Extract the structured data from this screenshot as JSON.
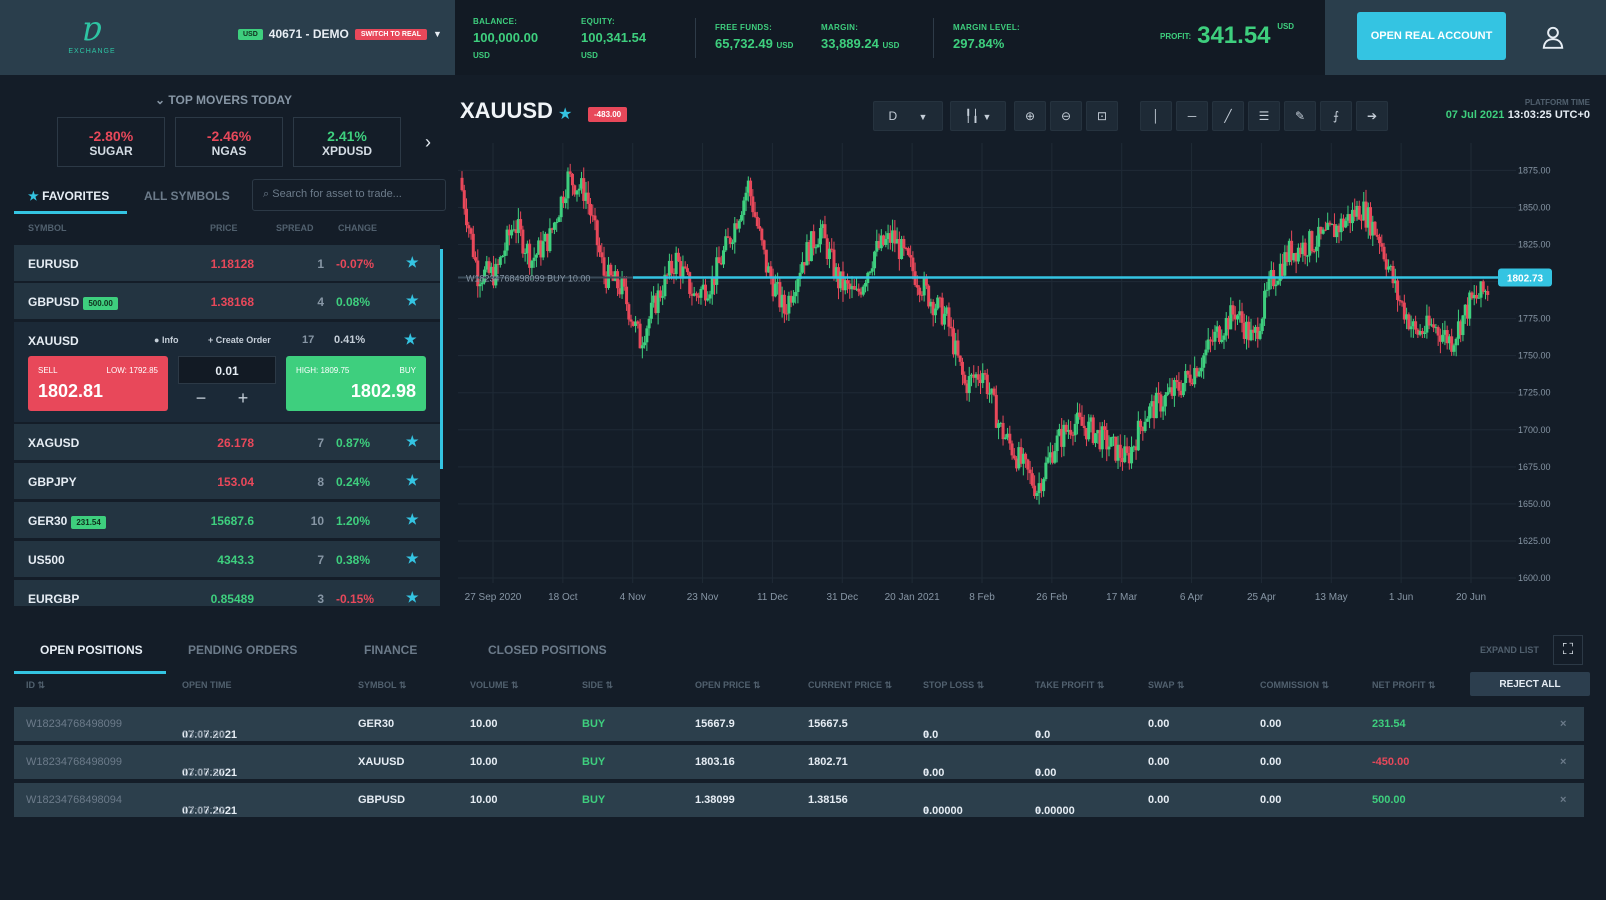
{
  "header": {
    "logo_mark": "ɐ",
    "logo_text": "EXCHANGE",
    "account_tag": "USD",
    "account_name": "40671 - DEMO",
    "account_badge": "SWITCH TO REAL",
    "stats": [
      {
        "label": "BALANCE:",
        "value": "100,000.00",
        "unit": "USD"
      },
      {
        "label": "EQUITY:",
        "value": "100,341.54",
        "unit": "USD"
      },
      {
        "label": "FREE FUNDS:",
        "value": "65,732.49",
        "unit": "USD"
      },
      {
        "label": "MARGIN:",
        "value": "33,889.24",
        "unit": "USD"
      },
      {
        "label": "MARGIN LEVEL:",
        "value": "297.84%",
        "unit": ""
      }
    ],
    "profit_label": "PROFIT:",
    "profit_value": "341.54",
    "profit_unit": "USD",
    "open_real_label": "OPEN REAL ACCOUNT"
  },
  "movers": {
    "title": "TOP MOVERS TODAY",
    "items": [
      {
        "pct": "-2.80%",
        "name": "SUGAR",
        "dir": "down"
      },
      {
        "pct": "-2.46%",
        "name": "NGAS",
        "dir": "down"
      },
      {
        "pct": "2.41%",
        "name": "XPDUSD",
        "dir": "up"
      }
    ]
  },
  "symbols": {
    "tab_favorites": "FAVORITES",
    "tab_all": "ALL SYMBOLS",
    "search_placeholder": "Search for asset to trade...",
    "columns": [
      "SYMBOL",
      "PRICE",
      "SPREAD",
      "CHANGE"
    ],
    "rows": [
      {
        "symbol": "EURUSD",
        "badge": "",
        "price": "1.18128",
        "spread": "1",
        "change": "-0.07%",
        "price_dir": "down",
        "change_dir": "down"
      },
      {
        "symbol": "GBPUSD",
        "badge": "500.00",
        "price": "1.38168",
        "spread": "4",
        "change": "0.08%",
        "price_dir": "down",
        "change_dir": "up"
      },
      {
        "symbol": "XAGUSD",
        "badge": "",
        "price": "26.178",
        "spread": "7",
        "change": "0.87%",
        "price_dir": "down",
        "change_dir": "up"
      },
      {
        "symbol": "GBPJPY",
        "badge": "",
        "price": "153.04",
        "spread": "8",
        "change": "0.24%",
        "price_dir": "down",
        "change_dir": "up"
      },
      {
        "symbol": "GER30",
        "badge": "231.54",
        "price": "15687.6",
        "spread": "10",
        "change": "1.20%",
        "price_dir": "up",
        "change_dir": "up"
      },
      {
        "symbol": "US500",
        "badge": "",
        "price": "4343.3",
        "spread": "7",
        "change": "0.38%",
        "price_dir": "up",
        "change_dir": "up"
      },
      {
        "symbol": "EURGBP",
        "badge": "",
        "price": "0.85489",
        "spread": "3",
        "change": "-0.15%",
        "price_dir": "up",
        "change_dir": "down"
      }
    ],
    "expanded": {
      "symbol": "XAUUSD",
      "info_label": "Info",
      "create_order_label": "Create Order",
      "spread": "17",
      "change": "0.41%",
      "sell_label": "SELL",
      "sell_low": "LOW: 1792.85",
      "sell_price": "1802.81",
      "buy_label": "BUY",
      "buy_high": "HIGH: 1809.75",
      "buy_price": "1802.98",
      "volume": "0.01",
      "minus": "−",
      "plus": "+"
    }
  },
  "chart": {
    "symbol": "XAUUSD",
    "badge": "-483.00",
    "timeframe": "D",
    "platform_time_label": "PLATFORM TIME",
    "platform_date": "07 Jul 2021",
    "platform_time": "13:03:25 UTC+0",
    "position_line_label": "W18234768498099 BUY 10.00",
    "current_price_label": "1802.73"
  },
  "chart_data": {
    "type": "line",
    "title": "",
    "xlabel": "",
    "ylabel": "",
    "x": [
      "27 Sep 2020",
      "18 Oct",
      "4 Nov",
      "23 Nov",
      "11 Dec",
      "31 Dec",
      "20 Jan 2021",
      "8 Feb",
      "26 Feb",
      "17 Mar",
      "6 Apr",
      "25 Apr",
      "13 May",
      "1 Jun",
      "20 Jun"
    ],
    "y_ticks": [
      "1875.00",
      "1850.00",
      "1825.00",
      "1800.00",
      "1775.00",
      "1750.00",
      "1725.00",
      "1700.00",
      "1675.00",
      "1650.00",
      "1625.00",
      "1600.00"
    ],
    "ylim": [
      1600,
      1880
    ],
    "series": [
      {
        "values": [
          1870,
          1805,
          1805,
          1840,
          1815,
          1830,
          1870,
          1860,
          1805,
          1795,
          1760,
          1790,
          1815,
          1790,
          1800,
          1830,
          1865,
          1810,
          1780,
          1815,
          1835,
          1800,
          1790,
          1820,
          1830,
          1810,
          1790,
          1775,
          1730,
          1740,
          1700,
          1680,
          1660,
          1690,
          1705,
          1700,
          1690,
          1680,
          1710,
          1720,
          1730,
          1745,
          1765,
          1780,
          1760,
          1800,
          1820,
          1825,
          1830,
          1840,
          1850,
          1830,
          1790,
          1765,
          1770,
          1760,
          1785,
          1795
        ]
      }
    ],
    "price_line": 1802.73
  },
  "positions": {
    "tabs": [
      "OPEN POSITIONS",
      "PENDING ORDERS",
      "FINANCE",
      "CLOSED POSITIONS"
    ],
    "expand_label": "EXPAND LIST",
    "columns": [
      "ID ⇅",
      "OPEN TIME",
      "SYMBOL ⇅",
      "VOLUME ⇅",
      "SIDE ⇅",
      "OPEN PRICE ⇅",
      "CURRENT PRICE ⇅",
      "STOP LOSS ⇅",
      "TAKE PROFIT ⇅",
      "SWAP ⇅",
      "COMMISSION ⇅",
      "NET PROFIT ⇅"
    ],
    "reject_all_label": "REJECT ALL",
    "rows": [
      {
        "id": "W18234768498099",
        "date": "07.07.2021",
        "time": "13:00:00",
        "symbol": "GER30",
        "volume": "10.00",
        "side": "BUY",
        "open_price": "15667.9",
        "current_price": "15667.5",
        "stop_loss": "0.0",
        "take_profit": "0.0",
        "swap": "0.00",
        "commission": "0.00",
        "net_profit": "231.54",
        "profit_dir": "up"
      },
      {
        "id": "W18234768498099",
        "date": "07.07.2021",
        "time": "13:00:57",
        "symbol": "XAUUSD",
        "volume": "10.00",
        "side": "BUY",
        "open_price": "1803.16",
        "current_price": "1802.71",
        "stop_loss": "0.00",
        "take_profit": "0.00",
        "swap": "0.00",
        "commission": "0.00",
        "net_profit": "-450.00",
        "profit_dir": "down"
      },
      {
        "id": "W18234768498094",
        "date": "07.07.2021",
        "time": "13:00:12",
        "symbol": "GBPUSD",
        "volume": "10.00",
        "side": "BUY",
        "open_price": "1.38099",
        "current_price": "1.38156",
        "stop_loss": "0.00000",
        "take_profit": "0.00000",
        "swap": "0.00",
        "commission": "0.00",
        "net_profit": "500.00",
        "profit_dir": "up"
      }
    ]
  },
  "colors": {
    "up": "#3ecf7e",
    "down": "#e8485a",
    "accent": "#34c4e2"
  }
}
